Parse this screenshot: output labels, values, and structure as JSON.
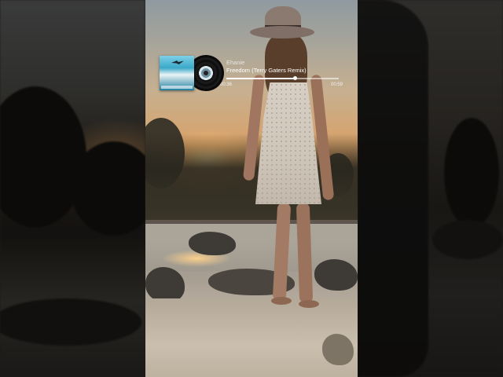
{
  "player": {
    "artist": "Ehanie",
    "track_title": "Freedom (Terry Gaters Remix)",
    "elapsed": "00:36",
    "total": "00:59",
    "progress": 0.61
  },
  "icons": {
    "cover": "album-cover-icon",
    "record": "vinyl-record-icon"
  }
}
